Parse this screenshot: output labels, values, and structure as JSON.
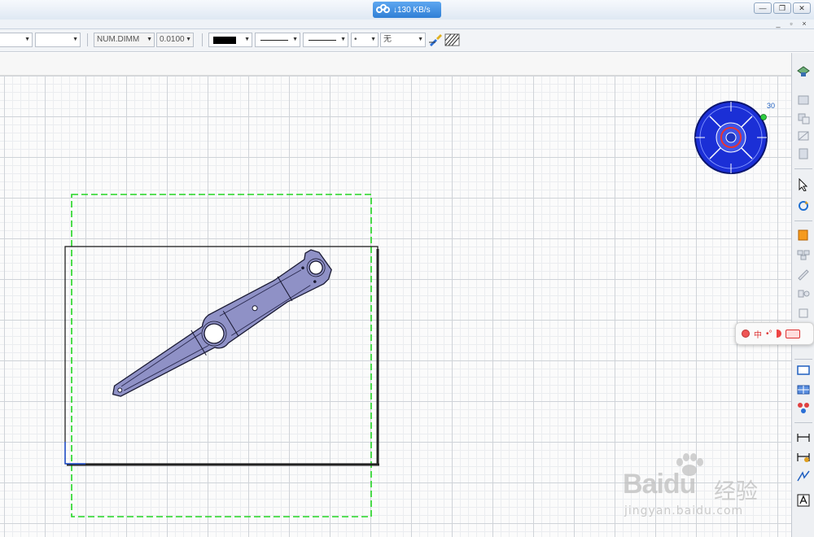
{
  "titlebar": {
    "download_speed": "↓130 KB/s",
    "minimize_icon": "minimize-icon",
    "restore_icon": "restore-icon",
    "close_icon": "close-icon"
  },
  "mdi": {
    "minimize": "_",
    "restore": "▫",
    "close": "×"
  },
  "toolbar": {
    "style_combo": "",
    "font_combo": "",
    "dim_style": "NUM.DIMM",
    "tolerance": "0.0100",
    "color_swatch": "#000000",
    "line_type": "solid",
    "line_thickness": "solid",
    "point_type": "•",
    "pattern": "无",
    "pattern_edit_icon": "brush-icon",
    "hatch_icon": "hatch-icon"
  },
  "compass": {
    "angle_label": "30"
  },
  "ime": {
    "zh_label": "中",
    "punct": "•°"
  },
  "watermark": {
    "logo": "Baidu",
    "cn": "经验",
    "url": "jingyan.baidu.com"
  },
  "colors": {
    "frame_green": "#22d622",
    "part_fill": "#8f91c6",
    "part_outline": "#1a1a33",
    "compass_blue": "#1b2fd6",
    "accent_red": "#e53333"
  },
  "rtoolbar_icons": [
    "view-3d-icon",
    "view-front-icon",
    "view-projection-icon",
    "view-section-icon",
    "view-detail-icon",
    "select-icon",
    "update-icon",
    "sheet-icon",
    "views-icon",
    "sketch-icon",
    "geometry-icon",
    "dimension-icon",
    "rectangle-icon",
    "table-icon",
    "constraint-icon",
    "dim-length-icon",
    "dim-chain-icon",
    "annotation-icon",
    "text-icon"
  ]
}
